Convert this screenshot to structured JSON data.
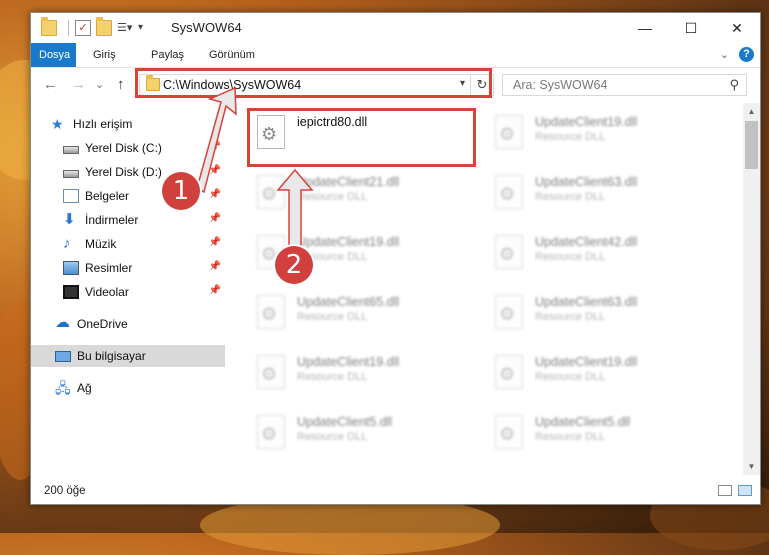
{
  "window": {
    "title": "SysWOW64",
    "minimize": "—",
    "maximize": "☐",
    "close": "✕"
  },
  "ribbon": {
    "tabs": [
      {
        "label": "Dosya"
      },
      {
        "label": "Giriş"
      },
      {
        "label": "Paylaş"
      },
      {
        "label": "Görünüm"
      }
    ],
    "help": "?"
  },
  "nav": {
    "back": "←",
    "forward": "→",
    "recent": "⌄",
    "up": "↑",
    "address": "C:\\Windows\\SysWOW64",
    "search_placeholder": "Ara: SysWOW64"
  },
  "sidebar": {
    "items": [
      {
        "label": "Hızlı erişim",
        "icon": "star-icon"
      },
      {
        "label": "Yerel Disk (C:)",
        "icon": "drive-icon"
      },
      {
        "label": "Yerel Disk (D:)",
        "icon": "drive-icon"
      },
      {
        "label": "Belgeler",
        "icon": "documents-icon"
      },
      {
        "label": "İndirmeler",
        "icon": "downloads-icon"
      },
      {
        "label": "Müzik",
        "icon": "music-icon"
      },
      {
        "label": "Resimler",
        "icon": "pictures-icon"
      },
      {
        "label": "Videolar",
        "icon": "videos-icon"
      },
      {
        "label": "OneDrive",
        "icon": "cloud-icon"
      },
      {
        "label": "Bu bilgisayar",
        "icon": "computer-icon"
      },
      {
        "label": "Ağ",
        "icon": "network-icon"
      }
    ]
  },
  "files": [
    {
      "name": "iepictrd80.dll",
      "type": ""
    },
    {
      "name": "UpdateClient19.dll",
      "type": "Resource DLL"
    },
    {
      "name": "UpdateClient21.dll",
      "type": "Resource DLL"
    },
    {
      "name": "UpdateClient63.dll",
      "type": "Resource DLL"
    },
    {
      "name": "UpdateClient19.dll",
      "type": "Resource DLL"
    },
    {
      "name": "UpdateClient42.dll",
      "type": "Resource DLL"
    },
    {
      "name": "UpdateClient65.dll",
      "type": "Resource DLL"
    },
    {
      "name": "UpdateClient63.dll",
      "type": "Resource DLL"
    },
    {
      "name": "UpdateClient19.dll",
      "type": "Resource DLL"
    },
    {
      "name": "UpdateClient19.dll",
      "type": "Resource DLL"
    },
    {
      "name": "UpdateClient5.dll",
      "type": "Resource DLL"
    },
    {
      "name": "UpdateClient5.dll",
      "type": "Resource DLL"
    }
  ],
  "status": {
    "item_count": "200 öğe"
  },
  "annotations": {
    "step1": "1",
    "step2": "2",
    "color": "#d9413b"
  }
}
